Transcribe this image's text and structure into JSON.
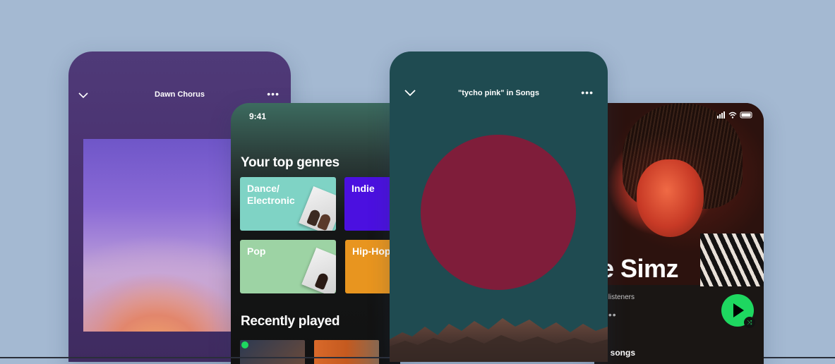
{
  "phone1": {
    "title": "Dawn Chorus",
    "more_icon": "more-dots-icon",
    "back_icon": "chevron-down-icon"
  },
  "phone2": {
    "time": "9:41",
    "genres_heading": "Your top genres",
    "genres": [
      {
        "label": "Dance/\nElectronic",
        "color": "#7fd3c5"
      },
      {
        "label": "Indie",
        "color": "#4b10e0"
      },
      {
        "label": "Pop",
        "color": "#9dd3a4"
      },
      {
        "label": "Hip-Hop",
        "color": "#e8951f"
      }
    ],
    "recent_heading": "Recently played"
  },
  "phone3": {
    "title": "\"tycho pink\" in Songs",
    "disc_color": "#7f1d3a",
    "bg_color": "#1f4b51"
  },
  "phone4": {
    "artist_name": "e Simz",
    "listeners": "y listeners",
    "songs_label": "d songs",
    "play_color": "#1ed760"
  }
}
